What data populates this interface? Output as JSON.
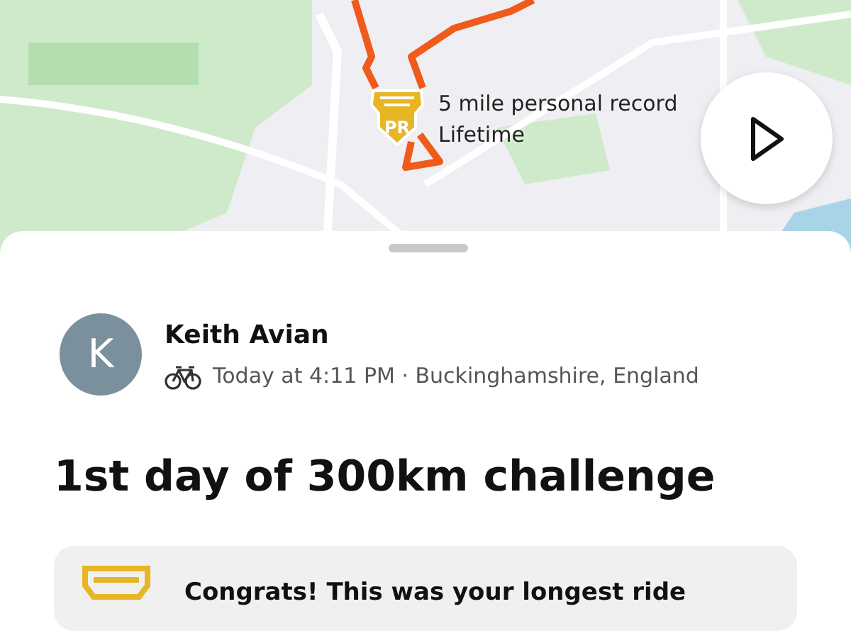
{
  "map": {
    "kind": "picture",
    "record": {
      "badge": "PR",
      "title": "5 mile personal record",
      "subtitle": "Lifetime"
    }
  },
  "activity": {
    "avatar_initial": "K",
    "athlete": "Keith Avian",
    "meta": "Today at 4:11 PM · Buckinghamshire, England",
    "title": "1st day of 300km challenge"
  },
  "achievement": {
    "text": "Congrats! This was your longest ride"
  }
}
